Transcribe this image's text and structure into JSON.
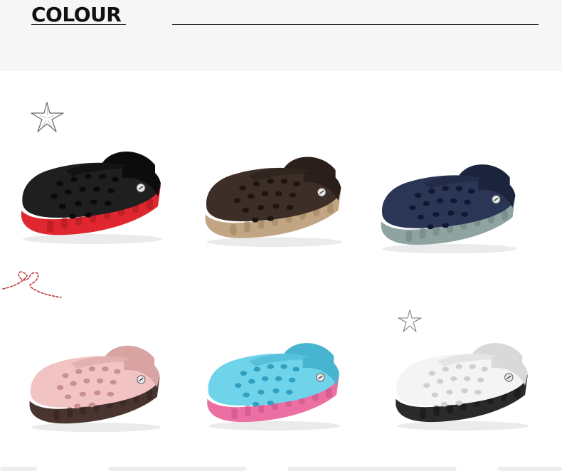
{
  "header": {
    "title": "COLOUR",
    "caption_left": "",
    "caption_right": ""
  },
  "products": [
    {
      "name": "black-red",
      "upper": "#1f1f1f",
      "upper_dark": "#0c0c0c",
      "sole": "#e0262e",
      "sole_dark": "#a51a20",
      "hole": "#0a0a0a"
    },
    {
      "name": "brown-khaki",
      "upper": "#3d2e27",
      "upper_dark": "#2a1f1a",
      "sole": "#c2a684",
      "sole_dark": "#9a7f60",
      "hole": "#1e1511"
    },
    {
      "name": "navy-grey",
      "upper": "#2b3555",
      "upper_dark": "#1c243d",
      "sole": "#8fa3a1",
      "sole_dark": "#6d8180",
      "hole": "#121830"
    },
    {
      "name": "pink-brown",
      "upper": "#f2c3c3",
      "upper_dark": "#d9a3a3",
      "sole": "#4a3430",
      "sole_dark": "#2f201d",
      "hole": "#c98e8e"
    },
    {
      "name": "skyblue-pink",
      "upper": "#6fd3ea",
      "upper_dark": "#47b5d0",
      "sole": "#ec6fa3",
      "sole_dark": "#c94f84",
      "hole": "#2fa0c0"
    },
    {
      "name": "white-black",
      "upper": "#f4f4f4",
      "upper_dark": "#d9d9d9",
      "sole": "#2a2a2a",
      "sole_dark": "#111111",
      "hole": "#cfcfcf"
    }
  ]
}
